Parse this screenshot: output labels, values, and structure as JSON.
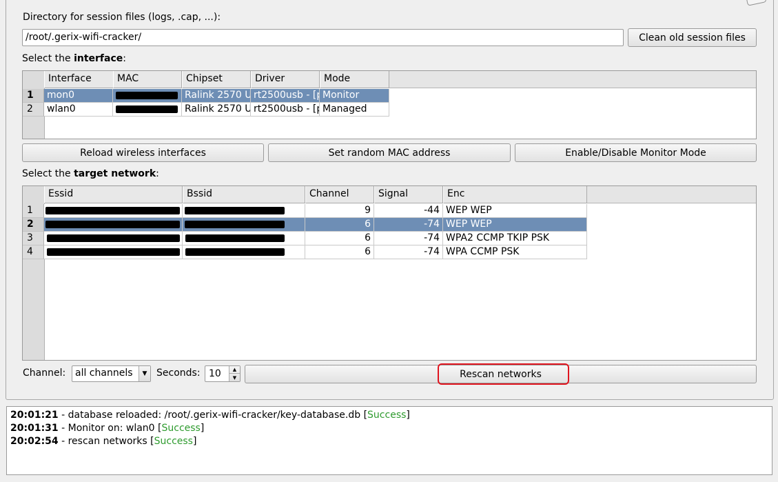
{
  "session": {
    "dir_label": "Directory for session files (logs, .cap, ...):",
    "dir_value": "/root/.gerix-wifi-cracker/",
    "clean_button": "Clean old session files"
  },
  "interface": {
    "label_prefix": "Select the ",
    "label_bold": "interface",
    "label_suffix": ":",
    "columns": [
      "Interface",
      "MAC",
      "Chipset",
      "Driver",
      "Mode"
    ],
    "rows": [
      {
        "num": "1",
        "interface": "mon0",
        "mac": "",
        "chipset": "Ralink 2570 U",
        "driver": "rt2500usb - [p",
        "mode": "Monitor",
        "selected": true
      },
      {
        "num": "2",
        "interface": "wlan0",
        "mac": "",
        "chipset": "Ralink 2570 U",
        "driver": "rt2500usb - [p",
        "mode": "Managed",
        "selected": false
      }
    ],
    "buttons": {
      "reload": "Reload wireless interfaces",
      "random_mac": "Set random MAC address",
      "monitor": "Enable/Disable Monitor Mode"
    }
  },
  "target": {
    "label_prefix": "Select the ",
    "label_bold": "target network",
    "label_suffix": ":",
    "columns": [
      "Essid",
      "Bssid",
      "Channel",
      "Signal",
      "Enc"
    ],
    "rows": [
      {
        "num": "1",
        "essid": "",
        "bssid": "",
        "channel": "9",
        "signal": "-44",
        "enc": "WEP WEP",
        "selected": false
      },
      {
        "num": "2",
        "essid": "",
        "bssid": "",
        "channel": "6",
        "signal": "-74",
        "enc": "WEP WEP",
        "selected": true
      },
      {
        "num": "3",
        "essid": "",
        "bssid": "",
        "channel": "6",
        "signal": "-74",
        "enc": "WPA2 CCMP TKIP PSK",
        "selected": false
      },
      {
        "num": "4",
        "essid": "",
        "bssid": "",
        "channel": "6",
        "signal": "-74",
        "enc": "WPA CCMP PSK",
        "selected": false
      }
    ]
  },
  "scan": {
    "channel_label": "Channel:",
    "channel_value": "all channels",
    "seconds_label": "Seconds:",
    "seconds_value": "10",
    "rescan_button": "Rescan networks"
  },
  "log": [
    {
      "time": "20:01:21",
      "text": " - database reloaded: /root/.gerix-wifi-cracker/key-database.db [",
      "status": "Success",
      "end": "]"
    },
    {
      "time": "20:01:31",
      "text": " - Monitor on: wlan0 [",
      "status": "Success",
      "end": "]"
    },
    {
      "time": "20:02:54",
      "text": " - rescan networks [",
      "status": "Success",
      "end": "]"
    }
  ],
  "colors": {
    "selection": "#6e8eb5",
    "success": "#2e9b2e",
    "highlight": "#e0141e"
  },
  "icons": {
    "combo_arrow": "chevron-down-icon",
    "spin_up": "caret-up-icon",
    "spin_down": "caret-down-icon"
  }
}
